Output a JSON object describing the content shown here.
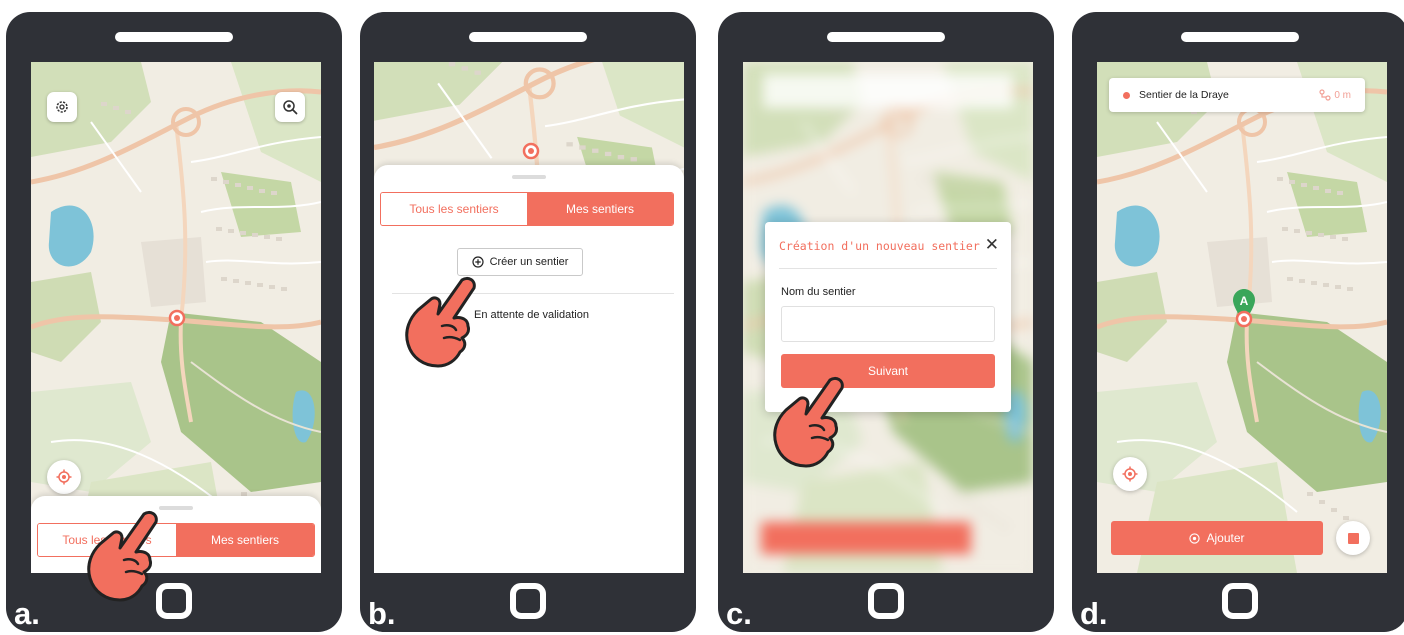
{
  "colors": {
    "accent": "#f26f5e",
    "phone_frame": "#2f3137",
    "map_green": "#b9cf9b",
    "map_water": "#7ec3d8"
  },
  "steps": {
    "a": {
      "label": "a.",
      "map_controls": [
        "gear-icon",
        "search-location-icon",
        "locate-icon"
      ],
      "tabs": {
        "all_trails": "Tous les sentiers",
        "my_trails": "Mes sentiers",
        "active": "my_trails"
      }
    },
    "b": {
      "label": "b.",
      "tabs": {
        "all_trails": "Tous les sentiers",
        "my_trails": "Mes sentiers",
        "active": "my_trails"
      },
      "create_button": "Créer un sentier",
      "pending_section": "En attente de validation"
    },
    "c": {
      "label": "c.",
      "modal": {
        "title": "Création d'un nouveau sentier",
        "close": "✕",
        "field_label": "Nom du sentier",
        "field_value": "",
        "next_button": "Suivant"
      }
    },
    "d": {
      "label": "d.",
      "trail_name": "Sentier de la Draye",
      "distance": "0 m",
      "start_marker": "A",
      "add_button": "Ajouter"
    }
  }
}
